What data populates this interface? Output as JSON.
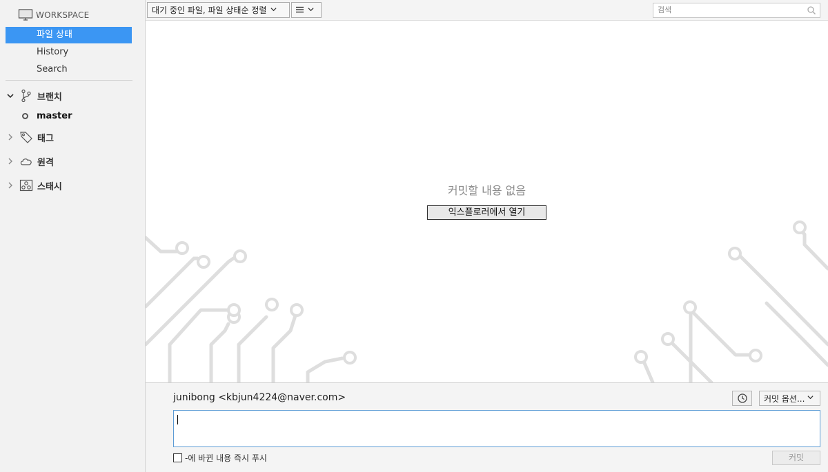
{
  "sidebar": {
    "workspace_label": "WORKSPACE",
    "nav": [
      {
        "label": "파일 상태",
        "active": true
      },
      {
        "label": "History",
        "active": false
      },
      {
        "label": "Search",
        "active": false
      }
    ],
    "groups": {
      "branches": {
        "label": "브랜치",
        "expanded": true,
        "items": [
          "master"
        ]
      },
      "tags": {
        "label": "태그",
        "expanded": false
      },
      "remotes": {
        "label": "원격",
        "expanded": false
      },
      "stashes": {
        "label": "스태시",
        "expanded": false
      }
    }
  },
  "toolbar": {
    "filter_dropdown": "대기 중인 파일, 파일 상태순 정렬",
    "view_dropdown_icon": "list-icon",
    "search_placeholder": "검색"
  },
  "content": {
    "empty_message": "커밋할 내용 없음",
    "open_explorer_label": "익스플로러에서 열기"
  },
  "commit": {
    "author": "junibong <kbjun4224@naver.com>",
    "message_value": "",
    "options_label": "커밋 옵션...",
    "push_checkbox_label": "-에 바뀐 내용 즉시 푸시",
    "push_checked": false,
    "commit_button_label": "커밋"
  },
  "colors": {
    "accent": "#3b96f3",
    "sidebar_bg": "#f2f2f2",
    "circuit": "#dedede"
  }
}
